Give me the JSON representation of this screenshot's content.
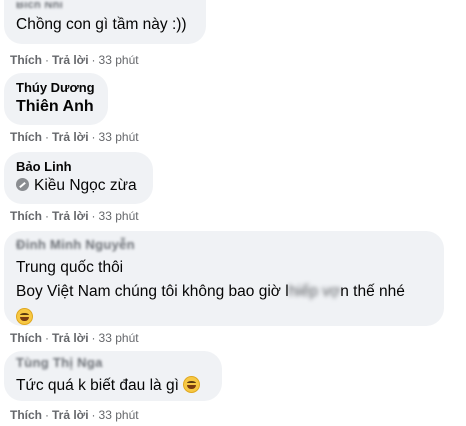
{
  "actions": {
    "like": "Thích",
    "reply": "Trả lời",
    "separator": "·",
    "time": "33 phút"
  },
  "comments": [
    {
      "author": "Bích Nhi",
      "author_blurred": true,
      "lines": [
        "Chồng con gì tầm này :))"
      ]
    },
    {
      "author": "Thúy Dương",
      "author_blurred": false,
      "lines": [
        "Thiên Anh"
      ]
    },
    {
      "author": "Bảo Linh",
      "author_blurred": false,
      "mention_icon": "tag-person-icon",
      "lines": [
        "Kiều Ngọc zừa"
      ]
    },
    {
      "author": "Đinh Minh Nguyễn",
      "author_blurred": true,
      "lines": [
        "Trung quốc thôi"
      ],
      "line2_before": "Boy Việt Nam chúng tôi không bao giờ l",
      "line2_hidden": "hiếp vợ",
      "line2_after": "n thế nhé",
      "emoji": "grinning-sweat-emoji"
    },
    {
      "author": "Tùng Thị Nga",
      "author_blurred": true,
      "lines": [
        "Tức quá k biết đau là gì"
      ],
      "emoji": "tears-of-joy-emoji"
    }
  ],
  "colors": {
    "bubble": "#f0f2f5",
    "meta": "#65676b",
    "text": "#050505"
  }
}
